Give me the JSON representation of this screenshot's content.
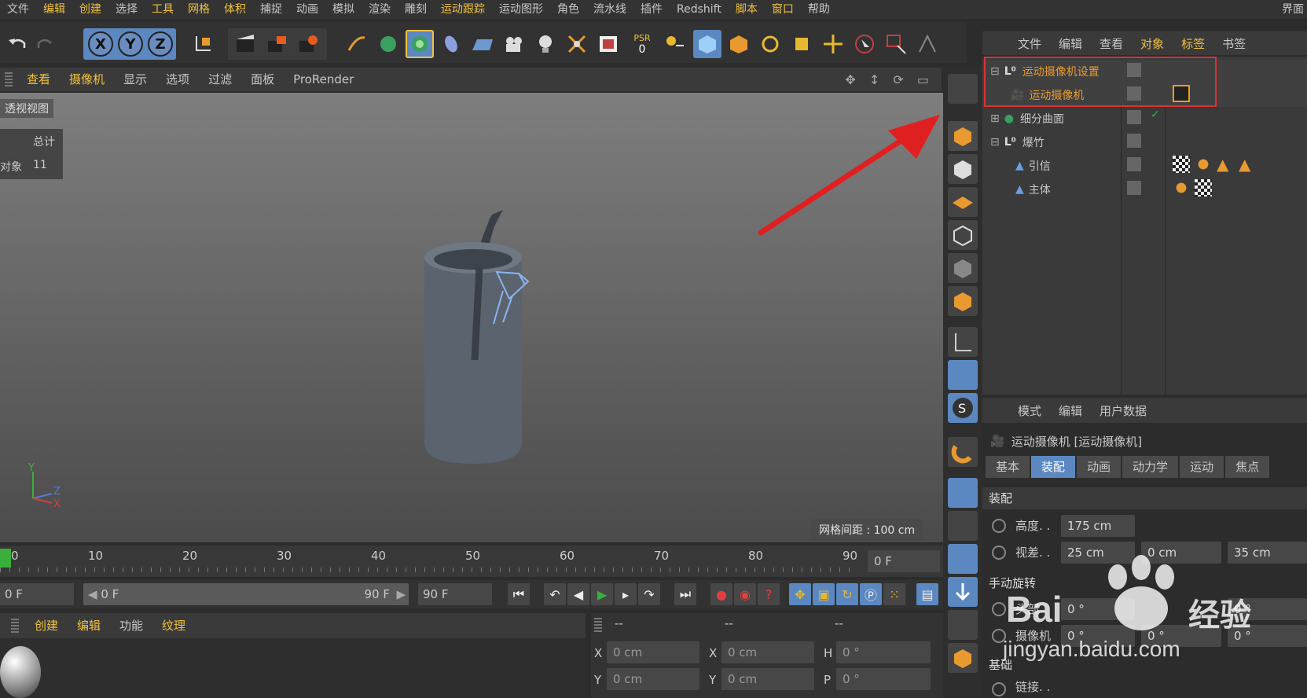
{
  "menubar": {
    "items": [
      "文件",
      "编辑",
      "创建",
      "选择",
      "工具",
      "网格",
      "体积",
      "捕捉",
      "动画",
      "模拟",
      "渲染",
      "雕刻",
      "运动跟踪",
      "运动图形",
      "角色",
      "流水线",
      "插件",
      "Redshift",
      "脚本",
      "窗口",
      "帮助"
    ],
    "right": "界面"
  },
  "toolbar": {
    "axis": [
      "X",
      "Y",
      "Z"
    ],
    "psr_label": "PSR",
    "psr_value": "0"
  },
  "viewport": {
    "menu": [
      "查看",
      "摄像机",
      "显示",
      "选项",
      "过滤",
      "面板",
      "ProRender"
    ],
    "label": "透视视图",
    "hud": {
      "header": "总计",
      "row_label": "对象",
      "row_value": "11"
    },
    "grid_spacing": "网格间距 : 100 cm",
    "axes": {
      "y": "Y",
      "z": "Z",
      "x": "X"
    }
  },
  "object_manager": {
    "menu": [
      "文件",
      "编辑",
      "查看",
      "对象",
      "标签",
      "书签"
    ],
    "rows": [
      {
        "name": "运动摄像机设置",
        "highlight": true
      },
      {
        "name": "运动摄像机",
        "highlight": true
      },
      {
        "name": "细分曲面",
        "highlight": false
      },
      {
        "name": "爆竹",
        "highlight": false
      },
      {
        "name": "引信",
        "highlight": false
      },
      {
        "name": "主体",
        "highlight": false
      }
    ]
  },
  "attributes": {
    "menu": [
      "模式",
      "编辑",
      "用户数据"
    ],
    "title": "运动摄像机 [运动摄像机]",
    "tabs": [
      "基本",
      "装配",
      "动画",
      "动力学",
      "运动",
      "焦点"
    ],
    "active_tab": "装配",
    "section_rig": "装配",
    "height_label": "高度. .",
    "height_value": "175 cm",
    "parallax_label": "视差. .",
    "parallax_values": [
      "25 cm",
      "0 cm",
      "35 cm"
    ],
    "section_manual": "手动旋转",
    "head_label": "头部",
    "head_values": [
      "0 °",
      "0 °"
    ],
    "cam_label": "摄像机",
    "cam_values": [
      "0 °",
      "0 °",
      "0 °"
    ],
    "section_base": "基础",
    "link_label": "链接. ."
  },
  "timeline": {
    "ticks": [
      "0",
      "10",
      "20",
      "30",
      "40",
      "50",
      "60",
      "70",
      "80",
      "90"
    ],
    "frame_field": "0 F"
  },
  "playback": {
    "start": "0 F",
    "range_start": "0 F",
    "range_end": "90 F",
    "end": "90 F"
  },
  "material_manager": {
    "menu": [
      "创建",
      "编辑",
      "功能",
      "纹理"
    ]
  },
  "coordinates": {
    "headers": [
      "--",
      "--",
      "--"
    ],
    "rows": [
      {
        "a": "X",
        "av": "0 cm",
        "b": "X",
        "bv": "0 cm",
        "c": "H",
        "cv": "0 °"
      },
      {
        "a": "Y",
        "av": "0 cm",
        "b": "Y",
        "bv": "0 cm",
        "c": "P",
        "cv": "0 °"
      }
    ]
  },
  "watermark": {
    "text": "Bai",
    "brand": "经验",
    "url": "jingyan.baidu.com"
  },
  "colors": {
    "accent_yellow": "#f0c040",
    "active_blue": "#5b88c0",
    "highlight_red": "#e03030"
  }
}
